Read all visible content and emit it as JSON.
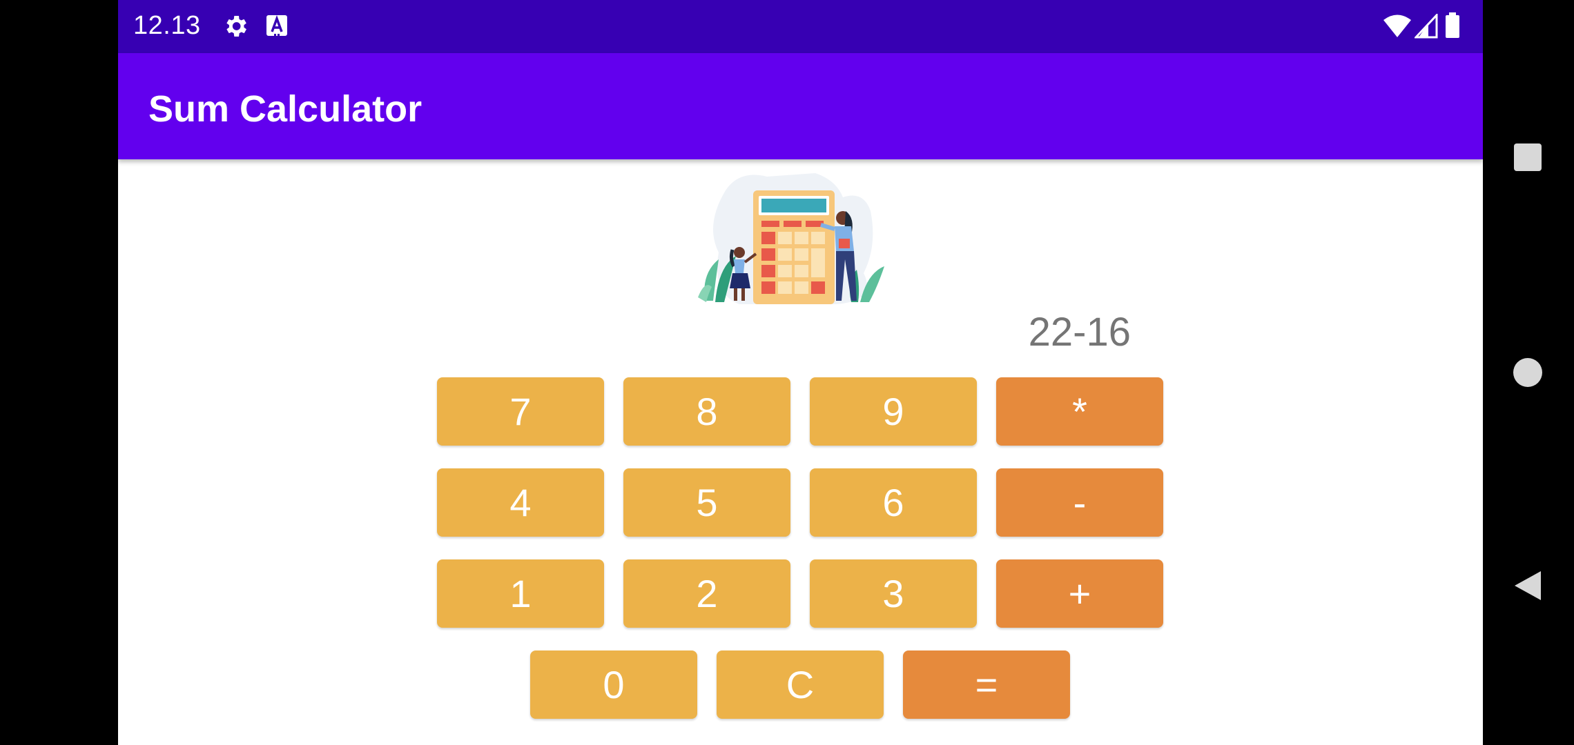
{
  "status_bar": {
    "time": "12.13",
    "icons": [
      "settings-gear-icon",
      "a-text-notification-icon",
      "wifi-icon",
      "cell-signal-icon",
      "battery-icon"
    ]
  },
  "app_bar": {
    "title": "Sum Calculator"
  },
  "illustration": {
    "subject": "calculator-illustration-icon"
  },
  "display": {
    "value": "22-16"
  },
  "keypad": {
    "rows": [
      [
        "7",
        "8",
        "9",
        "*"
      ],
      [
        "4",
        "5",
        "6",
        "-"
      ],
      [
        "1",
        "2",
        "3",
        "+"
      ],
      [
        "0",
        "C",
        "="
      ]
    ]
  },
  "nav_bar": {
    "icons": [
      "recents-square-icon",
      "home-circle-icon",
      "back-triangle-icon"
    ]
  },
  "colors": {
    "status_bar": "#3700b3",
    "app_bar": "#6200ee",
    "digit_key": "#ecb249",
    "operator_key": "#e68a3c",
    "display_text": "#757575"
  }
}
